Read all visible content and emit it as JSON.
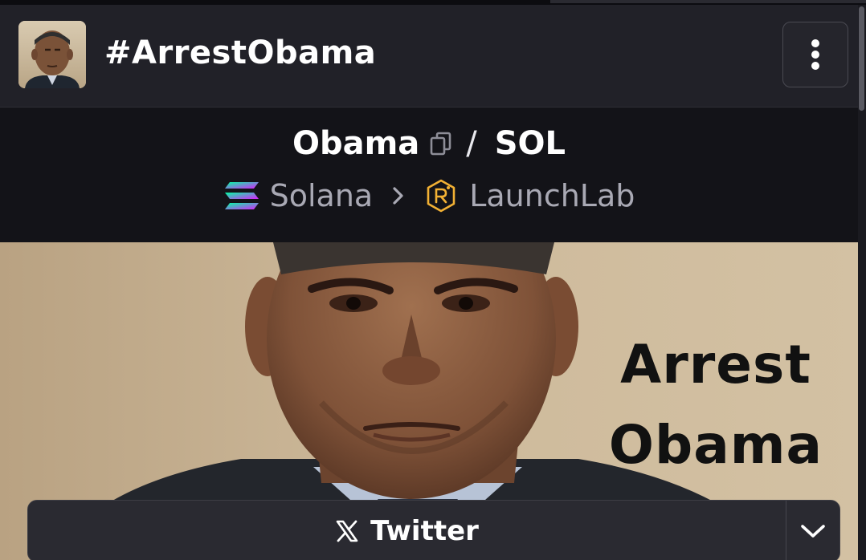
{
  "header": {
    "token_title": "#ArrestObama",
    "menu_icon": "vertical-dots-icon"
  },
  "pair": {
    "base_symbol": "Obama",
    "separator": "/",
    "quote_symbol": "SOL",
    "copy_icon": "copy-icon"
  },
  "chain": {
    "network_name": "Solana",
    "network_icon": "solana-icon",
    "chevron_icon": "chevron-right-icon",
    "dex_name": "LaunchLab",
    "dex_icon": "launchlab-icon"
  },
  "banner": {
    "line1": "Arrest",
    "line2": "Obama"
  },
  "social": {
    "label": "Twitter",
    "icon": "x-logo-icon",
    "toggle_icon": "chevron-down-icon"
  },
  "colors": {
    "background": "#17171d",
    "header_bg": "#212128",
    "pair_bg": "#131318",
    "text_primary": "#ffffff",
    "text_secondary": "#a9a9b4",
    "launchlab_accent": "#f2b134"
  }
}
